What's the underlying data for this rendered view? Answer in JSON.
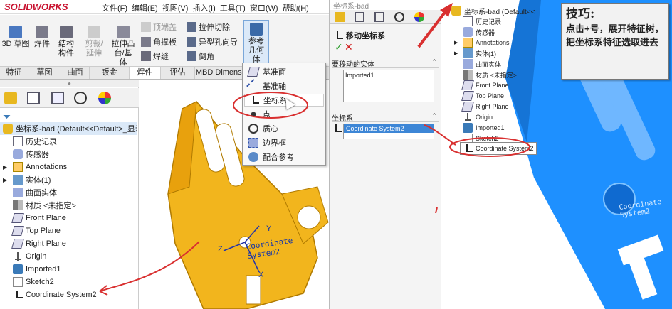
{
  "app": {
    "logo": "SOLIDWORKS",
    "menu": [
      "文件(F)",
      "编辑(E)",
      "视图(V)",
      "插入(I)",
      "工具(T)",
      "窗口(W)",
      "帮助(H)"
    ]
  },
  "ribbon": {
    "buttons": [
      "3D 草图",
      "焊件",
      "结构构件",
      "剪裁/延伸",
      "拉伸凸台/基体",
      "顶端盖",
      "角撑板",
      "焊缝",
      "拉伸切除",
      "异型孔向导",
      "倒角",
      "参考几何体"
    ],
    "tabs": [
      "特征",
      "草图",
      "曲面",
      "钣金",
      "焊件",
      "评估",
      "MBD Dimensi"
    ]
  },
  "ref_menu": [
    "基准面",
    "基准轴",
    "坐标系",
    "点",
    "质心",
    "边界框",
    "配合参考"
  ],
  "left_tree": {
    "root": "坐标系-bad  (Default<<Default>_显示",
    "items": [
      "历史记录",
      "传感器",
      "Annotations",
      "实体(1)",
      "曲面实体",
      "材质 <未指定>",
      "Front Plane",
      "Top Plane",
      "Right Plane",
      "Origin",
      "Imported1",
      "Sketch2",
      "Coordinate System2"
    ]
  },
  "viewport": {
    "cs_label": "Coordinate System2",
    "axis_x": "X",
    "axis_y": "Y",
    "axis_z": "Z"
  },
  "mid_panel": {
    "tab_title": "坐标系-bad",
    "header": "移动坐标系",
    "section1": "要移动的实体",
    "section1_item": "Imported1",
    "section2": "坐标系",
    "section2_item": "Coordinate System2"
  },
  "right_tree": {
    "root": "坐标系-bad  (Default<<",
    "items": [
      "历史记录",
      "传感器",
      "Annotations",
      "实体(1)",
      "曲面实体",
      "材质 <未指定>",
      "Front Plane",
      "Top Plane",
      "Right Plane",
      "Origin",
      "Imported1",
      "Sketch2",
      "Coordinate System2"
    ]
  },
  "tip": {
    "title": "技巧:",
    "body": "点击+号，展开特征树，把坐标系特征选取进去"
  },
  "right_view": {
    "cs_label": "Coordinate System2"
  }
}
